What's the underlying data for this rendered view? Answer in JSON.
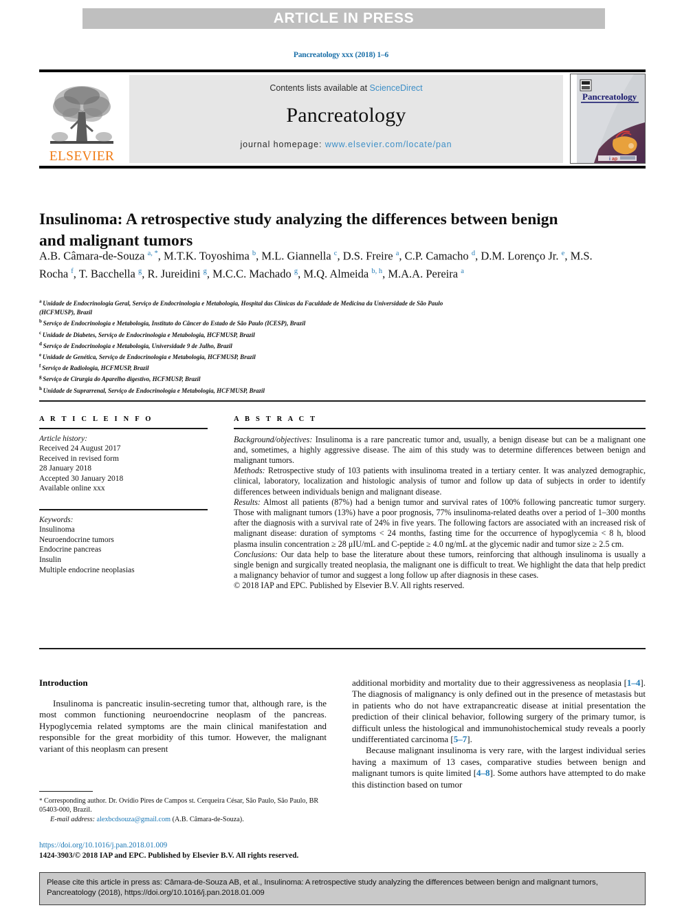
{
  "banner": {
    "label": "ARTICLE IN PRESS",
    "bg": "#bfbfbf",
    "text_color": "#ffffff"
  },
  "journal_ref": "Pancreatology xxx (2018) 1–6",
  "masthead": {
    "contents_prefix": "Contents lists available at ",
    "contents_link": "ScienceDirect",
    "journal_title": "Pancreatology",
    "homepage_prefix": "journal homepage: ",
    "homepage_link": "www.elsevier.com/locate/pan",
    "publisher_logo_text": "ELSEVIER",
    "publisher_logo_icon": "elsevier-tree-icon",
    "cover_title": "Pancreatology",
    "cover_icon": "journal-cover-thumbnail",
    "link_color": "#3d8fc7",
    "band_bg": "#e6e6e6"
  },
  "article": {
    "title": "Insulinoma: A retrospective study analyzing the differences between benign and malignant tumors",
    "authors": [
      {
        "name": "A.B. Câmara-de-Souza",
        "sup": "a, *"
      },
      {
        "name": "M.T.K. Toyoshima",
        "sup": "b"
      },
      {
        "name": "M.L. Giannella",
        "sup": "c"
      },
      {
        "name": "D.S. Freire",
        "sup": "a"
      },
      {
        "name": "C.P. Camacho",
        "sup": "d"
      },
      {
        "name": "D.M. Lorenço Jr.",
        "sup": "e"
      },
      {
        "name": "M.S. Rocha",
        "sup": "f"
      },
      {
        "name": "T. Bacchella",
        "sup": "g"
      },
      {
        "name": "R. Jureidini",
        "sup": "g"
      },
      {
        "name": "M.C.C. Machado",
        "sup": "g"
      },
      {
        "name": "M.Q. Almeida",
        "sup": "b, h"
      },
      {
        "name": "M.A.A. Pereira",
        "sup": "a"
      }
    ],
    "affiliations": [
      {
        "mark": "a",
        "lines": [
          "Unidade de Endocrinologia Geral, Serviço de Endocrinologia e Metabologia, Hospital das Clínicas da Faculdade de Medicina da Universidade de São Paulo",
          "(HCFMUSP), Brazil"
        ]
      },
      {
        "mark": "b",
        "lines": [
          "Serviço de Endocrinologia e Metabologia, Instituto do Câncer do Estado de São Paulo (ICESP), Brazil"
        ]
      },
      {
        "mark": "c",
        "lines": [
          "Unidade de Diabetes, Serviço de Endocrinologia e Metabologia, HCFMUSP, Brazil"
        ]
      },
      {
        "mark": "d",
        "lines": [
          "Serviço de Endocrinologia e Metabologia, Universidade 9 de Julho, Brazil"
        ]
      },
      {
        "mark": "e",
        "lines": [
          "Unidade de Genética, Serviço de Endocrinologia e Metabologia, HCFMUSP, Brazil"
        ]
      },
      {
        "mark": "f",
        "lines": [
          "Serviço de Radiologia, HCFMUSP, Brazil"
        ]
      },
      {
        "mark": "g",
        "lines": [
          "Serviço de Cirurgia do Aparelho digestivo, HCFMUSP, Brazil"
        ]
      },
      {
        "mark": "h",
        "lines": [
          "Unidade de Suprarrenal, Serviço de Endocrinologia e Metabologia, HCFMUSP, Brazil"
        ]
      }
    ]
  },
  "article_info": {
    "heading": "A R T I C L E  I N F O",
    "history_label": "Article history:",
    "history": [
      "Received 24 August 2017",
      "Received in revised form",
      "28 January 2018",
      "Accepted 30 January 2018",
      "Available online xxx"
    ],
    "keywords_label": "Keywords:",
    "keywords": [
      "Insulinoma",
      "Neuroendocrine tumors",
      "Endocrine pancreas",
      "Insulin",
      "Multiple endocrine neoplasias"
    ]
  },
  "abstract": {
    "heading": "A B S T R A C T",
    "sections": [
      {
        "label": "Background/objectives:",
        "text": " Insulinoma is a rare pancreatic tumor and, usually, a benign disease but can be a malignant one and, sometimes, a highly aggressive disease. The aim of this study was to determine differences between benign and malignant tumors."
      },
      {
        "label": "Methods:",
        "text": " Retrospective study of 103 patients with insulinoma treated in a tertiary center. It was analyzed demographic, clinical, laboratory, localization and histologic analysis of tumor and follow up data of subjects in order to identify differences between individuals benign and malignant disease."
      },
      {
        "label": "Results:",
        "text": " Almost all patients (87%) had a benign tumor and survival rates of 100% following pancreatic tumor surgery. Those with malignant tumors (13%) have a poor prognosis, 77% insulinoma-related deaths over a period of 1–300 months after the diagnosis with a survival rate of 24% in five years. The following factors are associated with an increased risk of malignant disease: duration of symptoms < 24 months, fasting time for the occurrence of hypoglycemia < 8 h, blood plasma insulin concentration ≥ 28 μIU/mL and C-peptide ≥ 4.0 ng/mL at the glycemic nadir and tumor size ≥ 2.5 cm."
      },
      {
        "label": "Conclusions:",
        "text": " Our data help to base the literature about these tumors, reinforcing that although insulinoma is usually a single benign and surgically treated neoplasia, the malignant one is difficult to treat. We highlight the data that help predict a malignancy behavior of tumor and suggest a long follow up after diagnosis in these cases."
      }
    ],
    "copyright": "© 2018 IAP and EPC. Published by Elsevier B.V. All rights reserved."
  },
  "body": {
    "intro_heading": "Introduction",
    "left_paragraphs": [
      "Insulinoma is pancreatic insulin-secreting tumor that, although rare, is the most common functioning neuroendocrine neoplasm of the pancreas. Hypoglycemia related symptoms are the main clinical manifestation and responsible for the great morbidity of this tumor. However, the malignant variant of this neoplasm can present"
    ],
    "right_paragraphs": [
      {
        "parts": [
          {
            "t": "additional morbidity and mortality due to their aggressiveness as neoplasia [",
            "link": false
          },
          {
            "t": "1–4",
            "link": true
          },
          {
            "t": "]. The diagnosis of malignancy is only defined out in the presence of metastasis but in patients who do not have extrapancreatic disease at initial presentation the prediction of their clinical behavior, following surgery of the primary tumor, is difficult unless the histological and immunohistochemical study reveals a poorly undifferentiated carcinoma [",
            "link": false
          },
          {
            "t": "5–7",
            "link": true
          },
          {
            "t": "].",
            "link": false
          }
        ],
        "indent": false
      },
      {
        "parts": [
          {
            "t": "Because malignant insulinoma is very rare, with the largest individual series having a maximum of 13 cases, comparative studies between benign and malignant tumors is quite limited [",
            "link": false
          },
          {
            "t": "4–8",
            "link": true
          },
          {
            "t": "]. Some authors have attempted to do make this distinction based on tumor",
            "link": false
          }
        ],
        "indent": true
      }
    ]
  },
  "footnote": {
    "star": "*",
    "corresponding": " Corresponding author. Dr. Ovídio Pires de Campos st. Cerqueira César, São Paulo, São Paulo, BR 05403-000, Brazil.",
    "email_label": "E-mail address:",
    "email": "alexbcdsouza@gmail.com",
    "email_attrib": " (A.B. Câmara-de-Souza).",
    "doi": "https://doi.org/10.1016/j.pan.2018.01.009",
    "issn_line": "1424-3903/© 2018 IAP and EPC. Published by Elsevier B.V. All rights reserved."
  },
  "citation_footer": {
    "text": "Please cite this article in press as: Câmara-de-Souza AB, et al., Insulinoma: A retrospective study analyzing the differences between benign and malignant tumors, Pancreatology (2018), https://doi.org/10.1016/j.pan.2018.01.009",
    "bg": "#c9c9c9"
  }
}
